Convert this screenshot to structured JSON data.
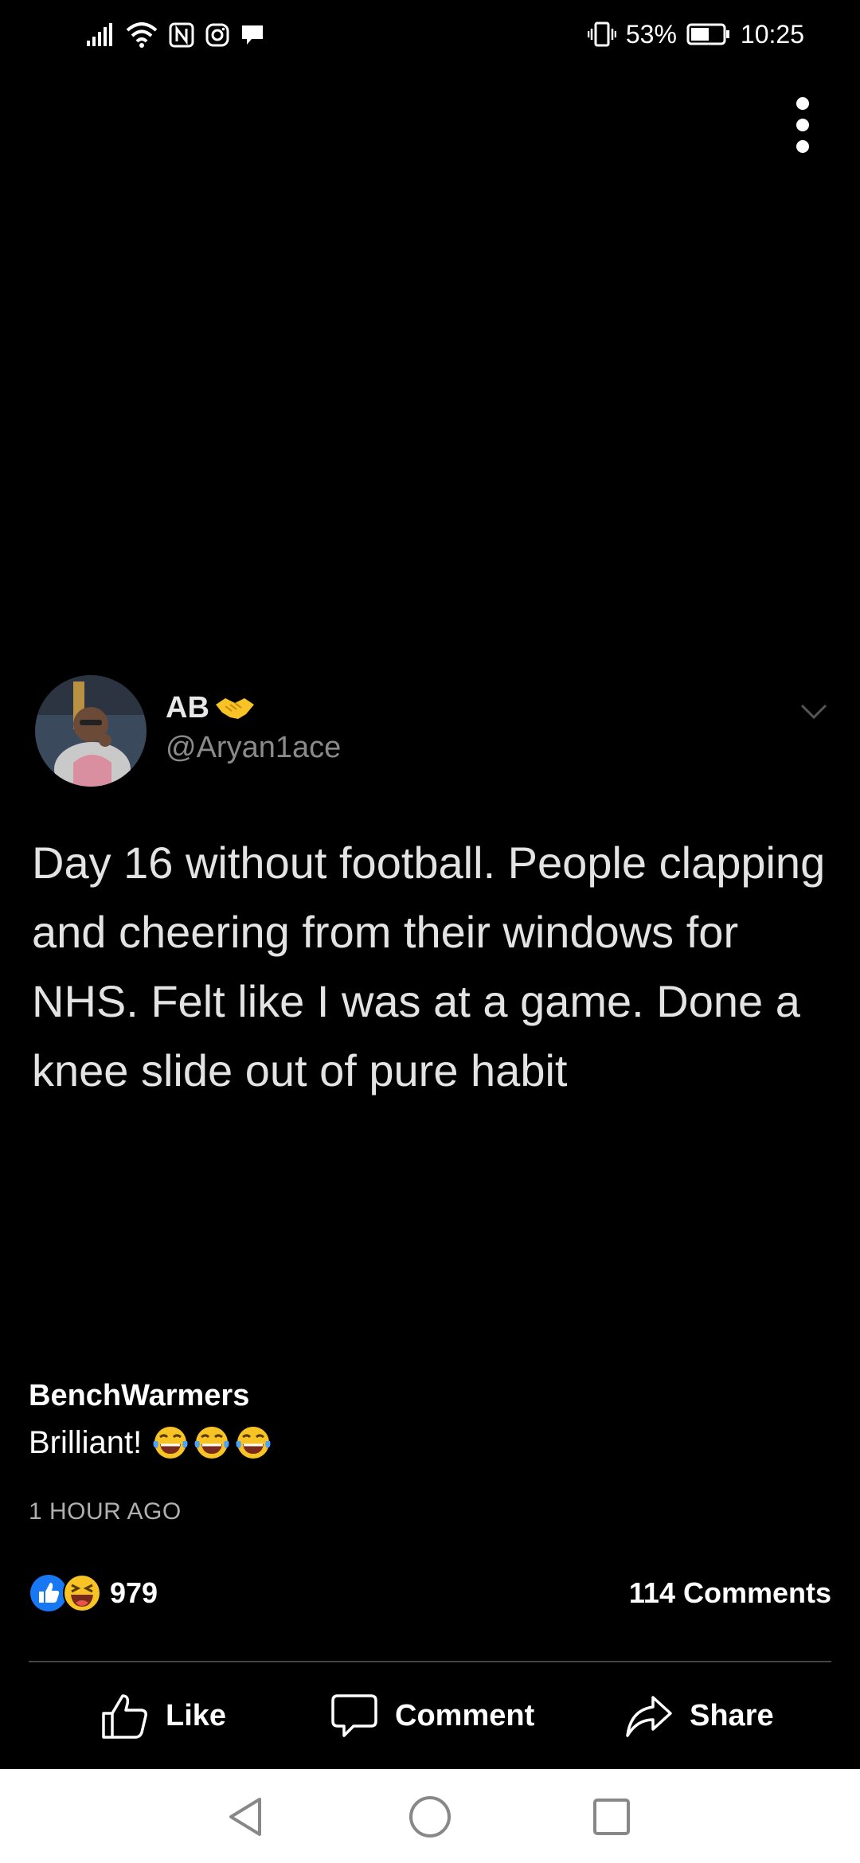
{
  "status_bar": {
    "battery_percent": "53%",
    "time": "10:25"
  },
  "menu": {
    "icon": "more-vertical-icon"
  },
  "tweet": {
    "author_name": "AB",
    "author_emoji": "handshake-emoji",
    "handle": "@Aryan1ace",
    "text": "Day 16 without football. People clapping and cheering from their windows for NHS. Felt like I was at a game. Done a knee slide out of pure habit"
  },
  "post": {
    "page_name": "BenchWarmers",
    "caption": "Brilliant!",
    "caption_emojis": [
      "tears-of-joy-emoji",
      "tears-of-joy-emoji",
      "tears-of-joy-emoji"
    ],
    "timestamp": "1 HOUR AGO"
  },
  "engagement": {
    "reaction_count": "979",
    "comments": "114 Comments"
  },
  "actions": {
    "like": "Like",
    "comment": "Comment",
    "share": "Share"
  },
  "colors": {
    "background": "#000000",
    "like_blue": "#1877f2",
    "emoji_yellow": "#f7c325"
  }
}
